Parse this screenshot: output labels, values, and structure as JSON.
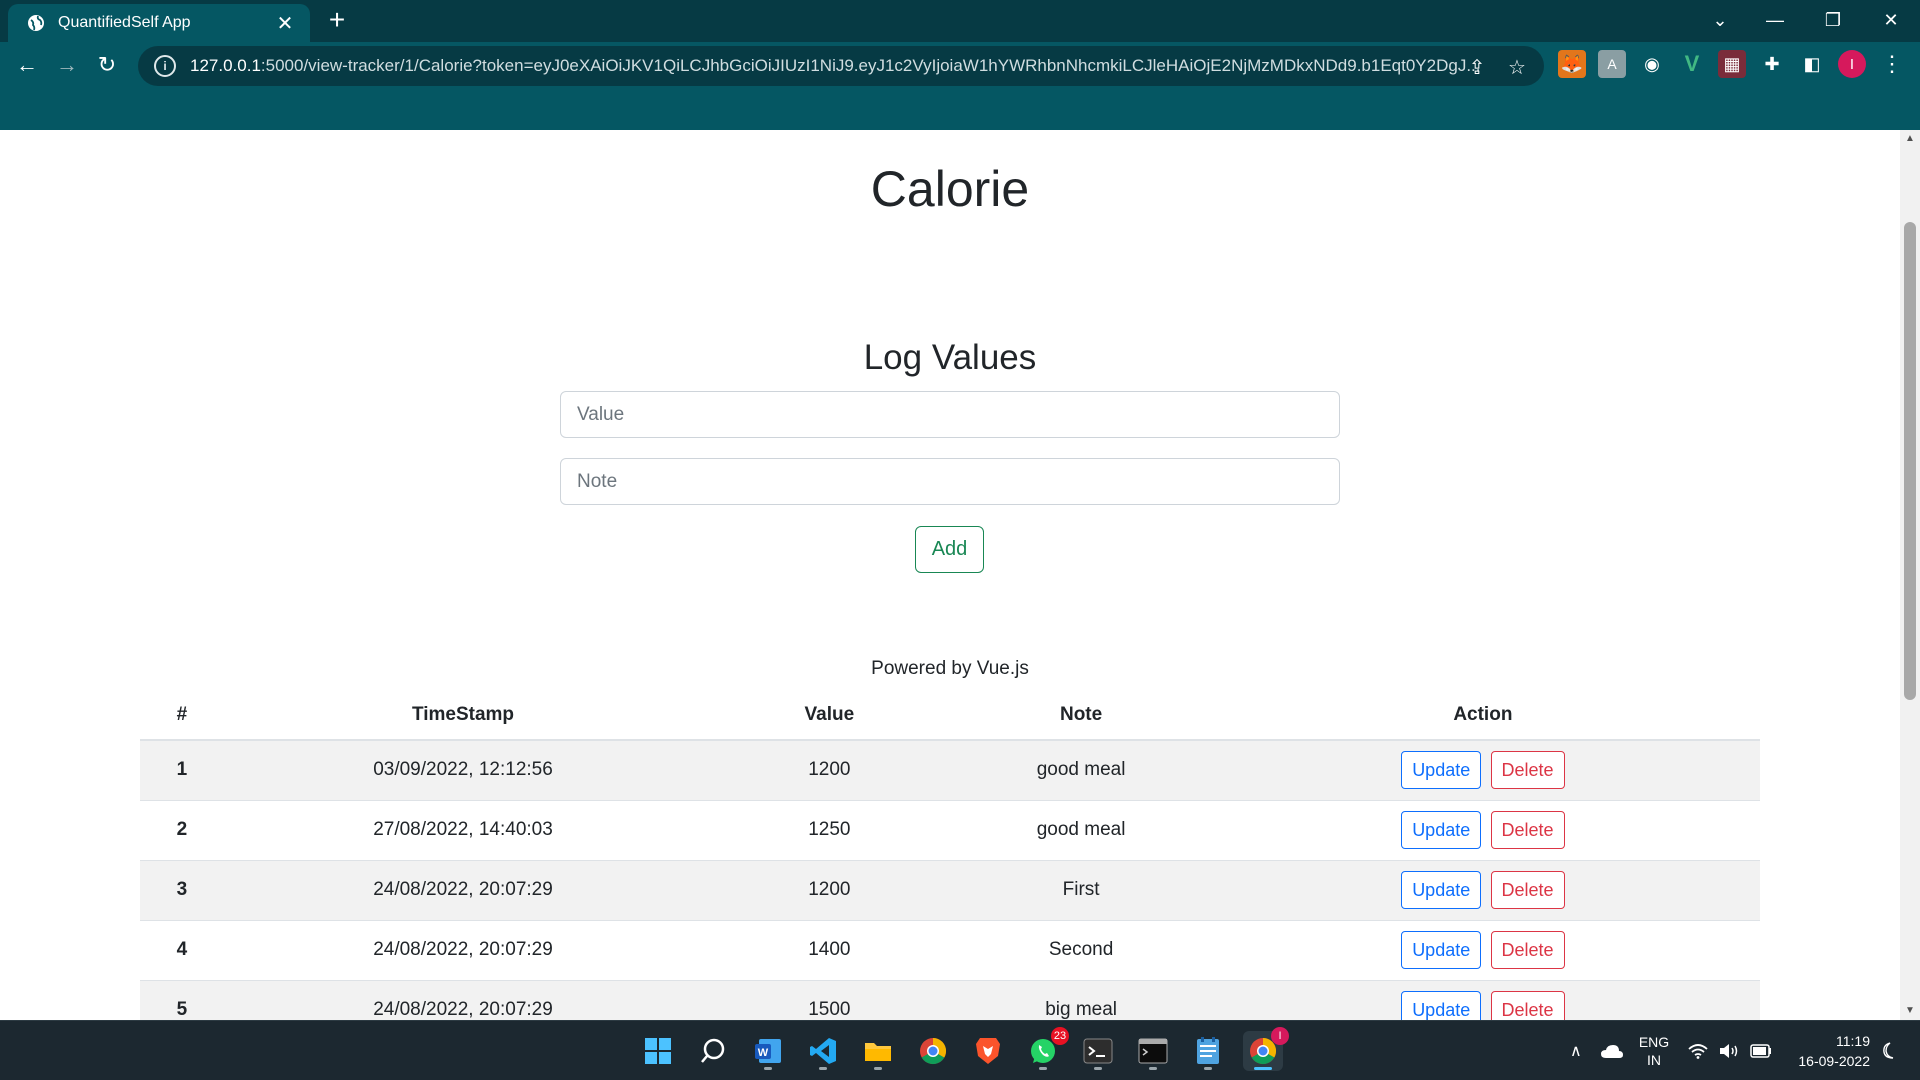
{
  "browser": {
    "tab_title": "QuantifiedSelf App",
    "url_host": "127.0.0.1",
    "url_rest": ":5000/view-tracker/1/Calorie?token=eyJ0eXAiOiJKV1QiLCJhbGciOiJIUzI1NiJ9.eyJ1c2VyIjoiaW1hYWRhbnNhcmkiLCJleHAiOjE2NjMzMDkxNDd9.b1Eqt0Y2DgJ...",
    "profile_initial": "I"
  },
  "page": {
    "title": "Calorie",
    "form_title": "Log Values",
    "value_placeholder": "Value",
    "note_placeholder": "Note",
    "add_label": "Add",
    "powered_by": "Powered by Vue.js"
  },
  "table": {
    "headers": [
      "#",
      "TimeStamp",
      "Value",
      "Note",
      "Action"
    ],
    "update_label": "Update",
    "delete_label": "Delete",
    "rows": [
      {
        "idx": "1",
        "timestamp": "03/09/2022, 12:12:56",
        "value": "1200",
        "note": "good meal"
      },
      {
        "idx": "2",
        "timestamp": "27/08/2022, 14:40:03",
        "value": "1250",
        "note": "good meal"
      },
      {
        "idx": "3",
        "timestamp": "24/08/2022, 20:07:29",
        "value": "1200",
        "note": "First"
      },
      {
        "idx": "4",
        "timestamp": "24/08/2022, 20:07:29",
        "value": "1400",
        "note": "Second"
      },
      {
        "idx": "5",
        "timestamp": "24/08/2022, 20:07:29",
        "value": "1500",
        "note": "big meal"
      }
    ]
  },
  "taskbar": {
    "whatsapp_badge": "23",
    "chrome_badge": "I",
    "lang_top": "ENG",
    "lang_bottom": "IN",
    "time": "11:19",
    "date": "16-09-2022"
  },
  "colors": {
    "chrome_dark": "#063a44",
    "chrome_toolbar": "#055763",
    "success": "#198754",
    "primary": "#0d6efd",
    "danger": "#dc3545"
  }
}
